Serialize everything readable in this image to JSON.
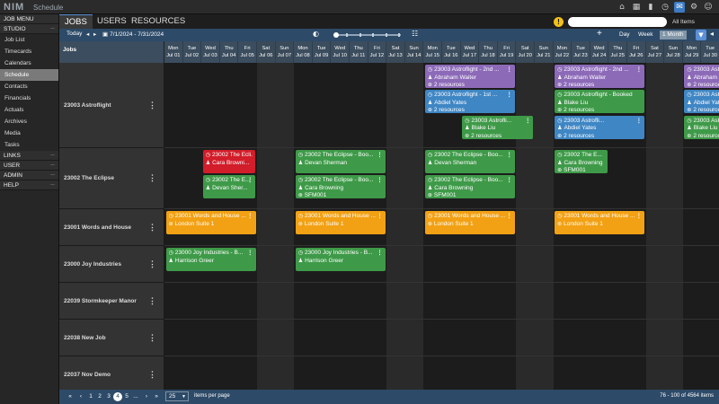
{
  "app": {
    "logo": "NIM",
    "title": "Schedule"
  },
  "topbar_icons": [
    "home-icon",
    "grid-icon",
    "bookmark-icon",
    "clock-icon",
    "mail-icon",
    "gear-icon",
    "user-icon"
  ],
  "sidebar": {
    "sections": [
      {
        "label": "JOB MENU",
        "items": []
      },
      {
        "label": "STUDIO",
        "items": [
          "Job List",
          "Timecards",
          "Calendars",
          "Schedule",
          "Contacts",
          "Financials",
          "Actuals",
          "Archives",
          "Media",
          "Tasks"
        ]
      },
      {
        "label": "LINKS",
        "items": []
      },
      {
        "label": "USER",
        "items": []
      },
      {
        "label": "ADMIN",
        "items": []
      },
      {
        "label": "HELP",
        "items": []
      }
    ],
    "active_item": "Schedule"
  },
  "tabs": [
    {
      "label": "JOBS",
      "active": true
    },
    {
      "label": "USERS",
      "active": false
    },
    {
      "label": "RESOURCES",
      "active": false
    }
  ],
  "search": {
    "placeholder": "",
    "filter": "All Items"
  },
  "toolbar": {
    "today": "Today",
    "prev": "◂",
    "next": "▸",
    "range": "7/1/2024 - 7/31/2024",
    "day": "Day",
    "week": "Week",
    "month": "1 Month",
    "add": "+"
  },
  "columns_header": "Jobs",
  "days": [
    {
      "dow": "Mon",
      "date": "Jul 01",
      "weekend": false
    },
    {
      "dow": "Tue",
      "date": "Jul 02",
      "weekend": false
    },
    {
      "dow": "Wed",
      "date": "Jul 03",
      "weekend": false
    },
    {
      "dow": "Thu",
      "date": "Jul 04",
      "weekend": false
    },
    {
      "dow": "Fri",
      "date": "Jul 05",
      "weekend": false
    },
    {
      "dow": "Sat",
      "date": "Jul 06",
      "weekend": true
    },
    {
      "dow": "Sun",
      "date": "Jul 07",
      "weekend": true
    },
    {
      "dow": "Mon",
      "date": "Jul 08",
      "weekend": false
    },
    {
      "dow": "Tue",
      "date": "Jul 09",
      "weekend": false
    },
    {
      "dow": "Wed",
      "date": "Jul 10",
      "weekend": false
    },
    {
      "dow": "Thu",
      "date": "Jul 11",
      "weekend": false
    },
    {
      "dow": "Fri",
      "date": "Jul 12",
      "weekend": false
    },
    {
      "dow": "Sat",
      "date": "Jul 13",
      "weekend": true
    },
    {
      "dow": "Sun",
      "date": "Jul 14",
      "weekend": true
    },
    {
      "dow": "Mon",
      "date": "Jul 15",
      "weekend": false
    },
    {
      "dow": "Tue",
      "date": "Jul 16",
      "weekend": false
    },
    {
      "dow": "Wed",
      "date": "Jul 17",
      "weekend": false
    },
    {
      "dow": "Thu",
      "date": "Jul 18",
      "weekend": false
    },
    {
      "dow": "Fri",
      "date": "Jul 19",
      "weekend": false
    },
    {
      "dow": "Sat",
      "date": "Jul 20",
      "weekend": true
    },
    {
      "dow": "Sun",
      "date": "Jul 21",
      "weekend": true
    },
    {
      "dow": "Mon",
      "date": "Jul 22",
      "weekend": false
    },
    {
      "dow": "Tue",
      "date": "Jul 23",
      "weekend": false
    },
    {
      "dow": "Wed",
      "date": "Jul 24",
      "weekend": false
    },
    {
      "dow": "Thu",
      "date": "Jul 25",
      "weekend": false
    },
    {
      "dow": "Fri",
      "date": "Jul 26",
      "weekend": false
    },
    {
      "dow": "Sat",
      "date": "Jul 27",
      "weekend": true
    },
    {
      "dow": "Sun",
      "date": "Jul 28",
      "weekend": true
    },
    {
      "dow": "Mon",
      "date": "Jul 29",
      "weekend": false
    },
    {
      "dow": "Tue",
      "date": "Jul 30",
      "weekend": false
    },
    {
      "dow": "Wed",
      "date": "Jul 31",
      "weekend": false
    }
  ],
  "rows": [
    {
      "name": "23003 Astroflight",
      "lanes": 3
    },
    {
      "name": "23002 The Eclipse",
      "lanes": 2
    },
    {
      "name": "23001 Words and House",
      "lanes": 1
    },
    {
      "name": "23000 Joy Industries",
      "lanes": 1
    },
    {
      "name": "22039 Stormkeeper Manor",
      "lanes": 1
    },
    {
      "name": "22038 New Job",
      "lanes": 1
    },
    {
      "name": "22037 Nov Demo",
      "lanes": 1
    }
  ],
  "events": [
    {
      "row": 0,
      "lane": 0,
      "start": 14,
      "days": 5,
      "color": "purple",
      "title": "23003 Astroflight - 2nd ...",
      "line2": "Abraham Waiter",
      "line2_icon": "user-icon",
      "line3": "2 resources",
      "line3_icon": "resources-icon",
      "menu": true
    },
    {
      "row": 0,
      "lane": 1,
      "start": 14,
      "days": 5,
      "color": "blue",
      "title": "23003 Astroflight - 1st ...",
      "line2": "Abdiel Yates",
      "line2_icon": "user-icon",
      "line3": "2 resources",
      "line3_icon": "resources-icon",
      "menu": true
    },
    {
      "row": 0,
      "lane": 2,
      "start": 16,
      "days": 4,
      "color": "green",
      "title": "23003 Astrofli...",
      "line2": "Blake Liu",
      "line2_icon": "user-icon",
      "line3": "2 resources",
      "line3_icon": "resources-icon",
      "menu": true
    },
    {
      "row": 0,
      "lane": 0,
      "start": 21,
      "days": 5,
      "color": "purple",
      "title": "23003 Astroflight - 2nd ...",
      "line2": "Abraham Waiter",
      "line2_icon": "user-icon",
      "line3": "2 resources",
      "line3_icon": "resources-icon",
      "menu": true
    },
    {
      "row": 0,
      "lane": 1,
      "start": 21,
      "days": 5,
      "color": "green",
      "title": "23003 Astroflight - Booked",
      "line2": "Blake Liu",
      "line2_icon": "user-icon",
      "line3": "2 resources",
      "line3_icon": "resources-icon",
      "menu": false
    },
    {
      "row": 0,
      "lane": 2,
      "start": 21,
      "days": 5,
      "color": "blue",
      "title": "23003 Astrofli...",
      "line2": "Abdiel Yates",
      "line2_icon": "user-icon",
      "line3": "2 resources",
      "line3_icon": "resources-icon",
      "menu": true
    },
    {
      "row": 0,
      "lane": 0,
      "start": 28,
      "days": 3,
      "color": "purple",
      "title": "23003 Astroflig...",
      "line2": "Abraham Wa...",
      "line2_icon": "user-icon",
      "line3": "2 resources",
      "line3_icon": "resources-icon",
      "menu": false
    },
    {
      "row": 0,
      "lane": 1,
      "start": 28,
      "days": 3,
      "color": "blue",
      "title": "23003 Astrofl...",
      "line2": "Abdiel Yates",
      "line2_icon": "user-icon",
      "line3": "2 resources",
      "line3_icon": "resources-icon",
      "menu": false
    },
    {
      "row": 0,
      "lane": 2,
      "start": 28,
      "days": 3,
      "color": "green",
      "title": "23003 Astrofli...",
      "line2": "Blake Liu",
      "line2_icon": "user-icon",
      "line3": "2 resources",
      "line3_icon": "resources-icon",
      "menu": false
    },
    {
      "row": 1,
      "lane": 0,
      "start": 2,
      "days": 3,
      "color": "red",
      "title": "23002 The Ecli...",
      "line2": "Cara Browni...",
      "line2_icon": "user-icon",
      "line3": "",
      "line3_icon": "",
      "menu": false
    },
    {
      "row": 1,
      "lane": 1,
      "start": 2,
      "days": 3,
      "color": "green",
      "title": "23002 The E...",
      "line2": "Devan Sher...",
      "line2_icon": "user-icon",
      "line3": "",
      "line3_icon": "",
      "menu": true
    },
    {
      "row": 1,
      "lane": 0,
      "start": 7,
      "days": 5,
      "color": "green",
      "title": "23002 The Eclipse - Boo...",
      "line2": "Devan Sherman",
      "line2_icon": "user-icon",
      "line3": "",
      "line3_icon": "",
      "menu": true
    },
    {
      "row": 1,
      "lane": 1,
      "start": 7,
      "days": 5,
      "color": "green",
      "title": "23002 The Eclipse - Boo...",
      "line2": "Cara Browning",
      "line2_icon": "user-icon",
      "line3": "SFM001",
      "line3_icon": "resources-icon",
      "menu": true
    },
    {
      "row": 1,
      "lane": 0,
      "start": 14,
      "days": 5,
      "color": "green",
      "title": "23002 The Eclipse - Boo...",
      "line2": "Devan Sherman",
      "line2_icon": "user-icon",
      "line3": "",
      "line3_icon": "",
      "menu": true
    },
    {
      "row": 1,
      "lane": 1,
      "start": 14,
      "days": 5,
      "color": "green",
      "title": "23002 The Eclipse - Boo...",
      "line2": "Cara Browning",
      "line2_icon": "user-icon",
      "line3": "SFM001",
      "line3_icon": "resources-icon",
      "menu": true
    },
    {
      "row": 1,
      "lane": 0,
      "start": 21,
      "days": 3,
      "color": "green",
      "title": "23002 The E...",
      "line2": "Cara Browning",
      "line2_icon": "user-icon",
      "line3": "SFM001",
      "line3_icon": "resources-icon",
      "menu": false
    },
    {
      "row": 2,
      "lane": 0,
      "start": 0,
      "days": 5,
      "color": "orange",
      "title": "23001 Words and House ...",
      "line2": "London Suite 1",
      "line2_icon": "resources-icon",
      "line3": "",
      "line3_icon": "",
      "menu": true
    },
    {
      "row": 2,
      "lane": 0,
      "start": 7,
      "days": 5,
      "color": "orange",
      "title": "23001 Words and House ...",
      "line2": "London Suite 1",
      "line2_icon": "resources-icon",
      "line3": "",
      "line3_icon": "",
      "menu": true
    },
    {
      "row": 2,
      "lane": 0,
      "start": 14,
      "days": 5,
      "color": "orange",
      "title": "23001 Words and House ...",
      "line2": "London Suite 1",
      "line2_icon": "resources-icon",
      "line3": "",
      "line3_icon": "",
      "menu": true
    },
    {
      "row": 2,
      "lane": 0,
      "start": 21,
      "days": 5,
      "color": "orange",
      "title": "23001 Words and House ...",
      "line2": "London Suite 1",
      "line2_icon": "resources-icon",
      "line3": "",
      "line3_icon": "",
      "menu": true
    },
    {
      "row": 3,
      "lane": 0,
      "start": 0,
      "days": 5,
      "color": "green",
      "title": "23000 Joy Industries - B...",
      "line2": "Harrison Greer",
      "line2_icon": "user-icon",
      "line3": "",
      "line3_icon": "",
      "menu": true
    },
    {
      "row": 3,
      "lane": 0,
      "start": 7,
      "days": 5,
      "color": "green",
      "title": "23000 Joy Industries - B...",
      "line2": "Harrison Greer",
      "line2_icon": "user-icon",
      "line3": "",
      "line3_icon": "",
      "menu": true
    }
  ],
  "pagination": {
    "first": "«",
    "prev": "‹",
    "pages": [
      "1",
      "2",
      "3",
      "4",
      "5",
      "..."
    ],
    "active_page": "4",
    "next": "›",
    "last": "»",
    "per_page": "25",
    "per_page_label": "items per page",
    "count": "76 - 100 of 4564 items"
  },
  "colors": {
    "purple": "#8c6ab8",
    "blue": "#3f86c4",
    "green": "#3e9a48",
    "red": "#d21d2a",
    "orange": "#f2a114",
    "toolbar": "#2d4a68"
  }
}
